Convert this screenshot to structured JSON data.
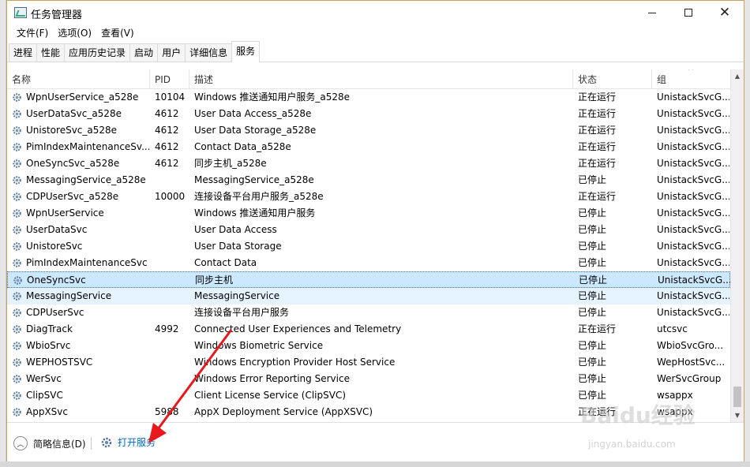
{
  "window": {
    "title": "任务管理器"
  },
  "menu": [
    "文件(F)",
    "选项(O)",
    "查看(V)"
  ],
  "tabs": [
    "进程",
    "性能",
    "应用历史记录",
    "启动",
    "用户",
    "详细信息",
    "服务"
  ],
  "active_tab": 6,
  "columns": {
    "name": "名称",
    "pid": "PID",
    "desc": "描述",
    "status": "状态",
    "group": "组"
  },
  "rows": [
    {
      "name": "WpnUserService_a528e",
      "pid": "10104",
      "desc": "Windows 推送通知用户服务_a528e",
      "status": "正在运行",
      "group": "UnistackSvcG..."
    },
    {
      "name": "UserDataSvc_a528e",
      "pid": "4612",
      "desc": "User Data Access_a528e",
      "status": "正在运行",
      "group": "UnistackSvcG..."
    },
    {
      "name": "UnistoreSvc_a528e",
      "pid": "4612",
      "desc": "User Data Storage_a528e",
      "status": "正在运行",
      "group": "UnistackSvcG..."
    },
    {
      "name": "PimIndexMaintenanceSv...",
      "pid": "4612",
      "desc": "Contact Data_a528e",
      "status": "正在运行",
      "group": "UnistackSvcG..."
    },
    {
      "name": "OneSyncSvc_a528e",
      "pid": "4612",
      "desc": "同步主机_a528e",
      "status": "正在运行",
      "group": "UnistackSvcG..."
    },
    {
      "name": "MessagingService_a528e",
      "pid": "",
      "desc": "MessagingService_a528e",
      "status": "已停止",
      "group": "UnistackSvcG..."
    },
    {
      "name": "CDPUserSvc_a528e",
      "pid": "10000",
      "desc": "连接设备平台用户服务_a528e",
      "status": "正在运行",
      "group": "UnistackSvcG..."
    },
    {
      "name": "WpnUserService",
      "pid": "",
      "desc": "Windows 推送通知用户服务",
      "status": "已停止",
      "group": "UnistackSvcG..."
    },
    {
      "name": "UserDataSvc",
      "pid": "",
      "desc": "User Data Access",
      "status": "已停止",
      "group": "UnistackSvcG..."
    },
    {
      "name": "UnistoreSvc",
      "pid": "",
      "desc": "User Data Storage",
      "status": "已停止",
      "group": "UnistackSvcG..."
    },
    {
      "name": "PimIndexMaintenanceSvc",
      "pid": "",
      "desc": "Contact Data",
      "status": "已停止",
      "group": "UnistackSvcG..."
    },
    {
      "name": "OneSyncSvc",
      "pid": "",
      "desc": "同步主机",
      "status": "已停止",
      "group": "UnistackSvcG..."
    },
    {
      "name": "MessagingService",
      "pid": "",
      "desc": "MessagingService",
      "status": "已停止",
      "group": "UnistackSvcG..."
    },
    {
      "name": "CDPUserSvc",
      "pid": "",
      "desc": "连接设备平台用户服务",
      "status": "已停止",
      "group": "UnistackSvcG..."
    },
    {
      "name": "DiagTrack",
      "pid": "4992",
      "desc": "Connected User Experiences and Telemetry",
      "status": "正在运行",
      "group": "utcsvc"
    },
    {
      "name": "WbioSrvc",
      "pid": "",
      "desc": "Windows Biometric Service",
      "status": "已停止",
      "group": "WbioSvcGro..."
    },
    {
      "name": "WEPHOSTSVC",
      "pid": "",
      "desc": "Windows Encryption Provider Host Service",
      "status": "已停止",
      "group": "WepHostSvc..."
    },
    {
      "name": "WerSvc",
      "pid": "",
      "desc": "Windows Error Reporting Service",
      "status": "已停止",
      "group": "WerSvcGroup"
    },
    {
      "name": "ClipSVC",
      "pid": "",
      "desc": "Client License Service (ClipSVC)",
      "status": "已停止",
      "group": "wsappx"
    },
    {
      "name": "AppXSvc",
      "pid": "5988",
      "desc": "AppX Deployment Service (AppXSVC)",
      "status": "正在运行",
      "group": "wsappx"
    }
  ],
  "selected_row": 11,
  "hover_row": 12,
  "footer": {
    "fewer_details": "简略信息(D)",
    "open_services": "打开服务"
  },
  "watermark": {
    "main": "Baidu经验",
    "sub": "jingyan.baidu.com"
  },
  "colors": {
    "link": "#0066cc",
    "selected": "#cce8ff",
    "hover": "#e5f3ff",
    "arrow": "#e8191c"
  }
}
